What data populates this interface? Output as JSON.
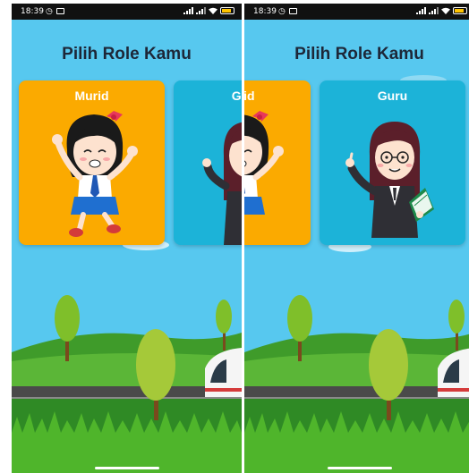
{
  "status_bar": {
    "time": "18:39"
  },
  "screen": {
    "title": "Pilih Role Kamu"
  },
  "roles": [
    {
      "label": "Murid"
    },
    {
      "label": "Guru"
    }
  ],
  "colors": {
    "sky": "#57c8ef",
    "murid_card": "#fbaa00",
    "guru_card": "#1cb3d8",
    "title_text": "#1d2738"
  }
}
